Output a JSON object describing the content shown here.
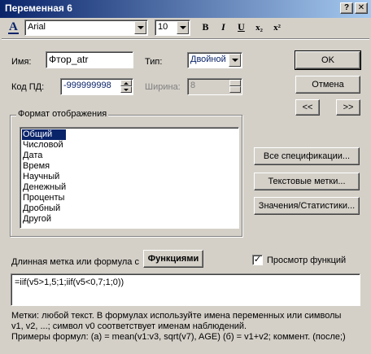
{
  "window": {
    "title": "Переменная 6",
    "help_label": "?",
    "close_label": "✕"
  },
  "toolbar": {
    "font_icon": "font-color-icon",
    "font_glyph": "A",
    "font_name": "Arial",
    "font_size": "10",
    "bold": "B",
    "italic": "I",
    "underline": "U",
    "subscript": "x₂",
    "superscript": "x²"
  },
  "fields": {
    "name_label": "Имя:",
    "name_value": "Фтор_atr",
    "type_label": "Тип:",
    "type_value": "Двойной",
    "md_code_label": "Код ПД:",
    "md_code_value": "-999999998",
    "width_label": "Ширина:",
    "width_value": "8"
  },
  "buttons": {
    "ok": "OK",
    "cancel": "Отмена",
    "prev": "<<",
    "next": ">>",
    "all_specs": "Все спецификации...",
    "text_labels": "Текстовые метки...",
    "values_stats": "Значения/Статистики...",
    "functions": "Функциями"
  },
  "format": {
    "title": "Формат отображения",
    "items": [
      "Общий",
      "Числовой",
      "Дата",
      "Время",
      "Научный",
      "Денежный",
      "Проценты",
      "Дробный",
      "Другой"
    ],
    "selected": "Общий"
  },
  "long_label": {
    "label": "Длинная метка или формула с",
    "preview_label": "Просмотр функций",
    "preview_checked": true,
    "formula": "=iif(v5>1,5;1;iif(v5<0,7;1;0))"
  },
  "help": {
    "line1": "Метки: любой текст.    В формулах используйте имена переменных или символы",
    "line2": "v1, v2, ...; символ v0 соответствует именам наблюдений.",
    "line3": "Примеры формул:   (a) = mean(v1:v3, sqrt(v7), AGE)   (б) = v1+v2; коммент. (после;)"
  }
}
